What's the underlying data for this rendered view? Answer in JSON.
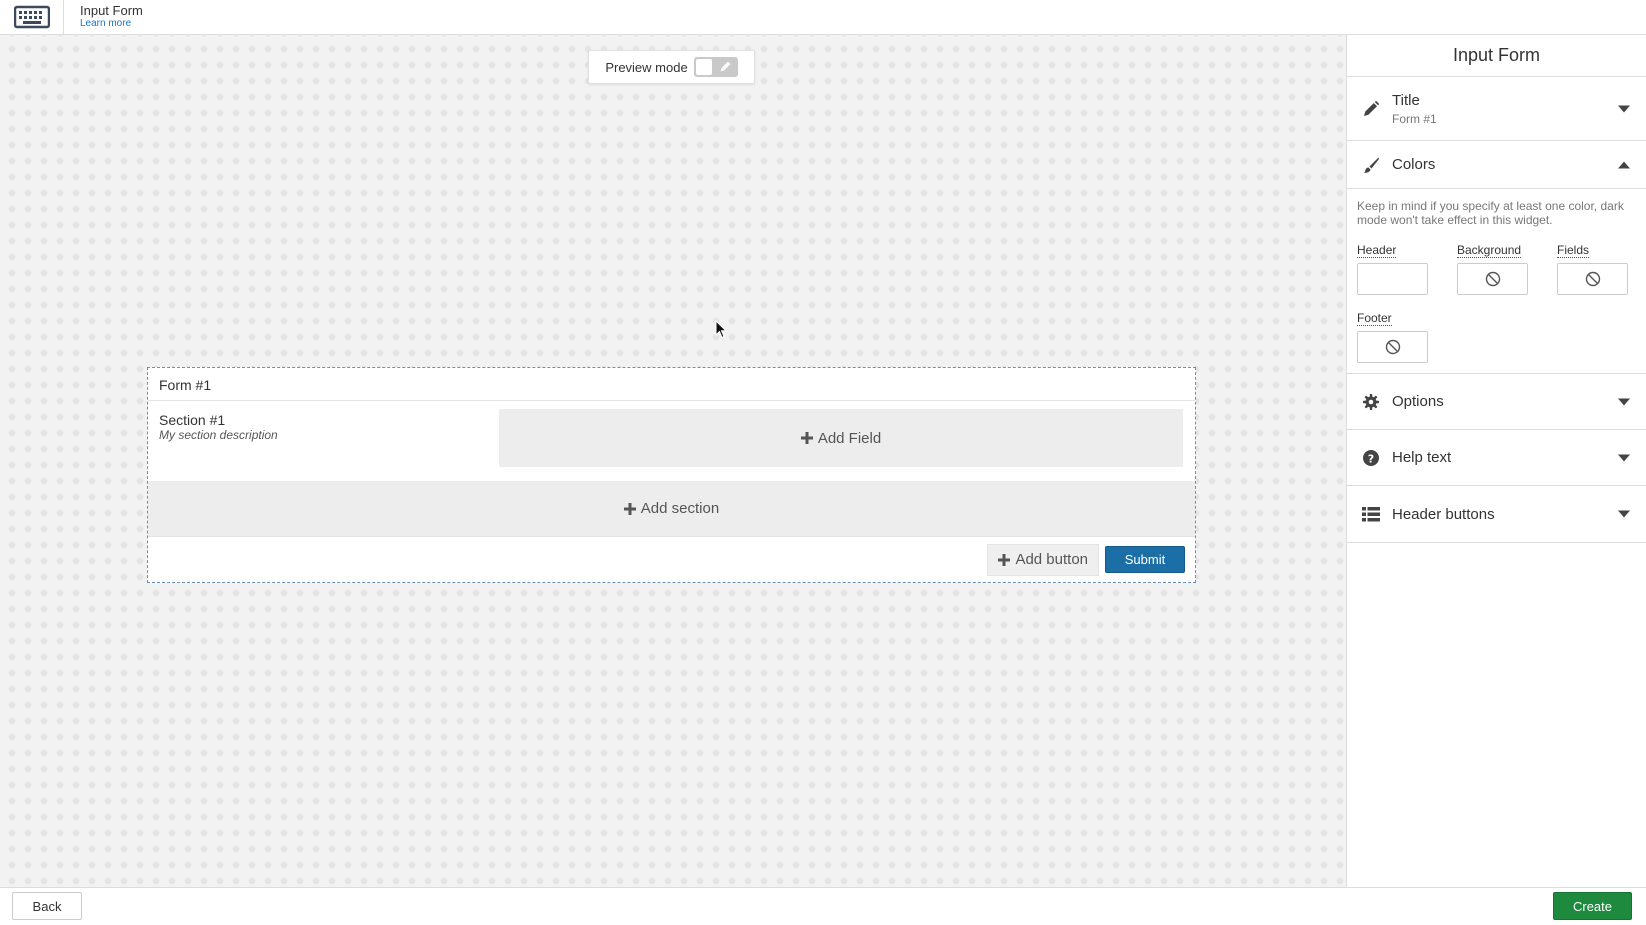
{
  "header": {
    "app_icon": "keyboard-icon",
    "title": "Input Form",
    "learn_more": "Learn more"
  },
  "canvas": {
    "preview_mode_label": "Preview mode",
    "preview_mode_on": false,
    "form": {
      "title": "Form #1",
      "section_title": "Section #1",
      "section_description": "My section description",
      "add_field_label": "Add Field",
      "add_section_label": "Add section",
      "add_button_label": "Add button",
      "submit_label": "Submit",
      "submit_color": "#1b6fa6"
    }
  },
  "panel": {
    "title": "Input Form",
    "sections": {
      "title": {
        "label": "Title",
        "value": "Form #1",
        "icon": "pencil-icon",
        "expanded": false
      },
      "colors": {
        "label": "Colors",
        "icon": "paintbrush-icon",
        "expanded": true,
        "note": "Keep in mind if you specify at least one color, dark mode won't take effect in this widget.",
        "header_label": "Header",
        "background_label": "Background",
        "fields_label": "Fields",
        "footer_label": "Footer"
      },
      "options": {
        "label": "Options",
        "icon": "gear-icon",
        "expanded": false
      },
      "help_text": {
        "label": "Help text",
        "icon": "question-circle-icon",
        "expanded": false
      },
      "header_buttons": {
        "label": "Header buttons",
        "icon": "list-icon",
        "expanded": false
      }
    }
  },
  "footer": {
    "back_label": "Back",
    "create_label": "Create",
    "create_color": "#1e8a3e"
  }
}
